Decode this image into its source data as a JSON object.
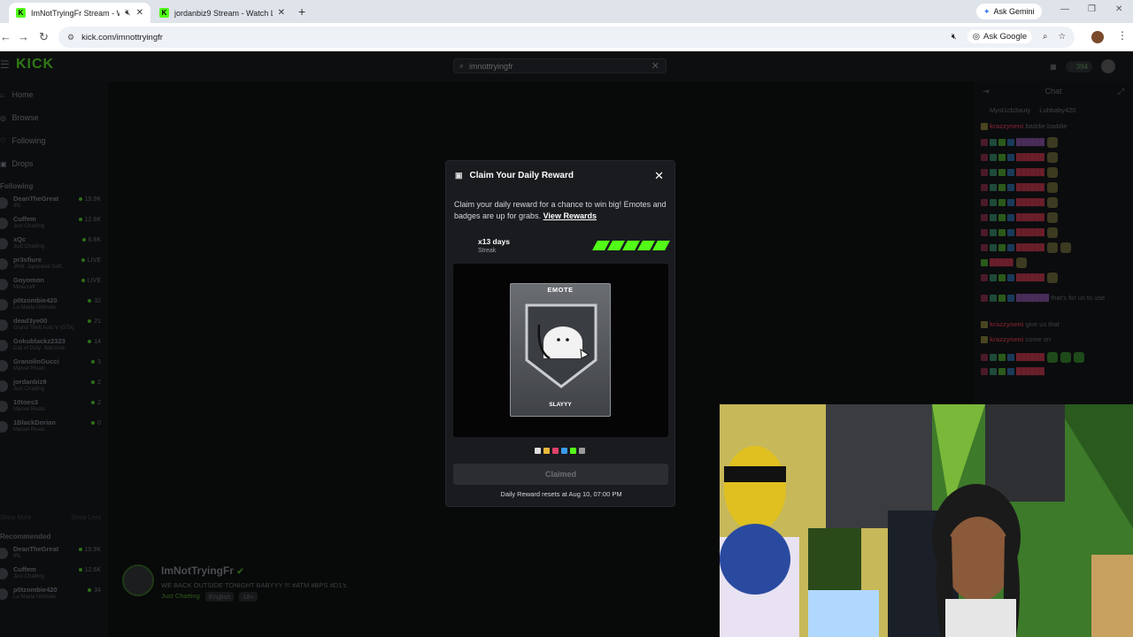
{
  "browser": {
    "tabs": [
      {
        "title": "ImNotTryingFr Stream - Wa",
        "active": true
      },
      {
        "title": "jordanbiz9 Stream - Watch Live",
        "active": false
      }
    ],
    "gemini_label": "Ask Gemini",
    "url": "kick.com/imnottryingfr",
    "ask_google_label": "Ask Google"
  },
  "kick": {
    "logo": "KICK",
    "search_value": "imnottryingfr",
    "viewer_count": "394",
    "nav": [
      {
        "label": "Home",
        "icon": "home-icon"
      },
      {
        "label": "Browse",
        "icon": "compass-icon"
      },
      {
        "label": "Following",
        "icon": "heart-icon"
      },
      {
        "label": "Drops",
        "icon": "gift-icon"
      }
    ],
    "following_label": "Following",
    "following": [
      {
        "name": "DeanTheGreat",
        "game": "IRL",
        "viewers": "15.9K"
      },
      {
        "name": "Cuffem",
        "game": "Just Chatting",
        "viewers": "12.6K"
      },
      {
        "name": "xQc",
        "game": "Just Chatting",
        "viewers": "6.8K"
      },
      {
        "name": "pr3sfiure",
        "game": "JRM: Japanese Drift...",
        "viewers": "LIVE"
      },
      {
        "name": "Goyomon",
        "game": "Minecraft",
        "viewers": "LIVE"
      },
      {
        "name": "p0tzombie420",
        "game": "La Maxia Ultimate",
        "viewers": "32"
      },
      {
        "name": "dead3ye00",
        "game": "Grand Theft Auto V (GTA)",
        "viewers": "21"
      },
      {
        "name": "Gokublackz2323",
        "game": "Call of Duty: Warzone",
        "viewers": "14"
      },
      {
        "name": "GranolinGucci",
        "game": "Marvel Rivals",
        "viewers": "3"
      },
      {
        "name": "jordanbiz9",
        "game": "Just Chatting",
        "viewers": "2"
      },
      {
        "name": "10toes3",
        "game": "Marvel Rivals",
        "viewers": "2"
      },
      {
        "name": "1BlackDorian",
        "game": "Marvel Rivals",
        "viewers": "0"
      }
    ],
    "show_more": "Show More",
    "show_less": "Show Less",
    "recommended_label": "Recommended",
    "recommended": [
      {
        "name": "DeanTheGreat",
        "game": "IRL",
        "viewers": "15.9K"
      },
      {
        "name": "Cuffem",
        "game": "Just Chatting",
        "viewers": "12.6K"
      },
      {
        "name": "p0tzombie420",
        "game": "La Maxia Ultimate",
        "viewers": "34"
      }
    ],
    "stream": {
      "name": "ImNotTryingFr",
      "title": "WE BACK OUTSIDE TONIGHT BABYYY !!! #ATM #BPS #D1's",
      "category": "Just Chatting",
      "language": "English",
      "rating": "18+"
    },
    "chat": {
      "title": "Chat",
      "pinned": [
        "Myst1cb3auty",
        "Luhbaby420"
      ],
      "messages": [
        {
          "user": "krazzyneni",
          "text": "baddie baddie"
        },
        {
          "user": "",
          "text": "that's for us to use"
        },
        {
          "user": "krazzyneni",
          "text": "give us that"
        },
        {
          "user": "krazzyneni",
          "text": "come on"
        }
      ]
    }
  },
  "modal": {
    "title": "Claim Your Daily Reward",
    "description": "Claim your daily reward for a chance to win big! Emotes and badges are up for grabs.",
    "view_rewards": "View Rewards",
    "streak_days": "x13 days",
    "streak_label": "Streak",
    "streak_segments_filled": 5,
    "card_type": "EMOTE",
    "card_name": "SLAYYY",
    "claim_button": "Claimed",
    "reset_text": "Daily Reward resets at Aug 10, 07:00 PM",
    "accent_color": "#53fc18",
    "swatch_colors": [
      "#dddddd",
      "#e8b73a",
      "#e0406a",
      "#3a9ae8",
      "#53fc18",
      "#9a9a9a"
    ]
  }
}
